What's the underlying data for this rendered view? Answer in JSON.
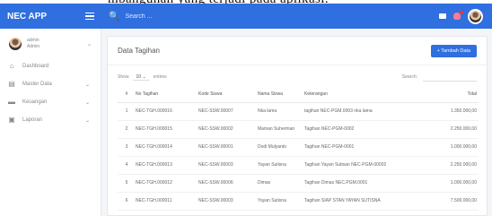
{
  "doc_text": "mbangunan yang terjadi pada aplikasi.",
  "navbar": {
    "brand": "NEC APP",
    "search_placeholder": "Search ..."
  },
  "sidebar": {
    "user_name": "admin",
    "user_role": "Admin",
    "items": [
      {
        "label": "Dashboard",
        "icon": "home-icon"
      },
      {
        "label": "Master Data",
        "icon": "database-icon"
      },
      {
        "label": "Keuangan",
        "icon": "money-icon"
      },
      {
        "label": "Laporan",
        "icon": "report-icon"
      }
    ]
  },
  "card": {
    "title": "Data Tagihan",
    "add_button": "+ Tambah Data",
    "show_label": "Show",
    "show_value": "10",
    "entries_label": "entries",
    "search_label": "Search:"
  },
  "table": {
    "headers": [
      "#",
      "No Tagihan",
      "Kode Siswa",
      "Nama Siswa",
      "Keterangan",
      "Total"
    ],
    "rows": [
      {
        "no": "1",
        "tagihan": "NEC-TGH.000016",
        "kode": "NEC-SSW.00007",
        "nama": "Nka lama",
        "ket": "tagihan NEC-PGM.0003 nka lama",
        "total": "1.350.000,00"
      },
      {
        "no": "2",
        "tagihan": "NEC-TGH.000015",
        "kode": "NEC-SSW.00002",
        "nama": "Maman Suherman",
        "ket": "Tagihan NEC-PGM-0002",
        "total": "2.250.000,00"
      },
      {
        "no": "3",
        "tagihan": "NEC-TGH.000014",
        "kode": "NEC-SSW.00001",
        "nama": "Dodi Mulyanto",
        "ket": "Tagihan NEC-PGM-0001",
        "total": "1.000.000,00"
      },
      {
        "no": "4",
        "tagihan": "NEC-TGH.000013",
        "kode": "NEC-SSW.00003",
        "nama": "Yayan Sutisna",
        "ket": "Tagihan Yayan Sutisan NEC-PGM-00002",
        "total": "2.250.000,00"
      },
      {
        "no": "5",
        "tagihan": "NEC-TGH.000012",
        "kode": "NEC-SSW.00006",
        "nama": "Dimas",
        "ket": "Tagihan Dimas NEC.PGM.0001",
        "total": "1.000.000,00"
      },
      {
        "no": "6",
        "tagihan": "NEC-TGH.000011",
        "kode": "NEC-SSW.00003",
        "nama": "Yayan Sutisna",
        "ket": "Tagihan SIAP STAN YAYAN SUTISNA",
        "total": "7.500.000,00"
      }
    ]
  },
  "colors": {
    "primary": "#2f6fe0"
  }
}
